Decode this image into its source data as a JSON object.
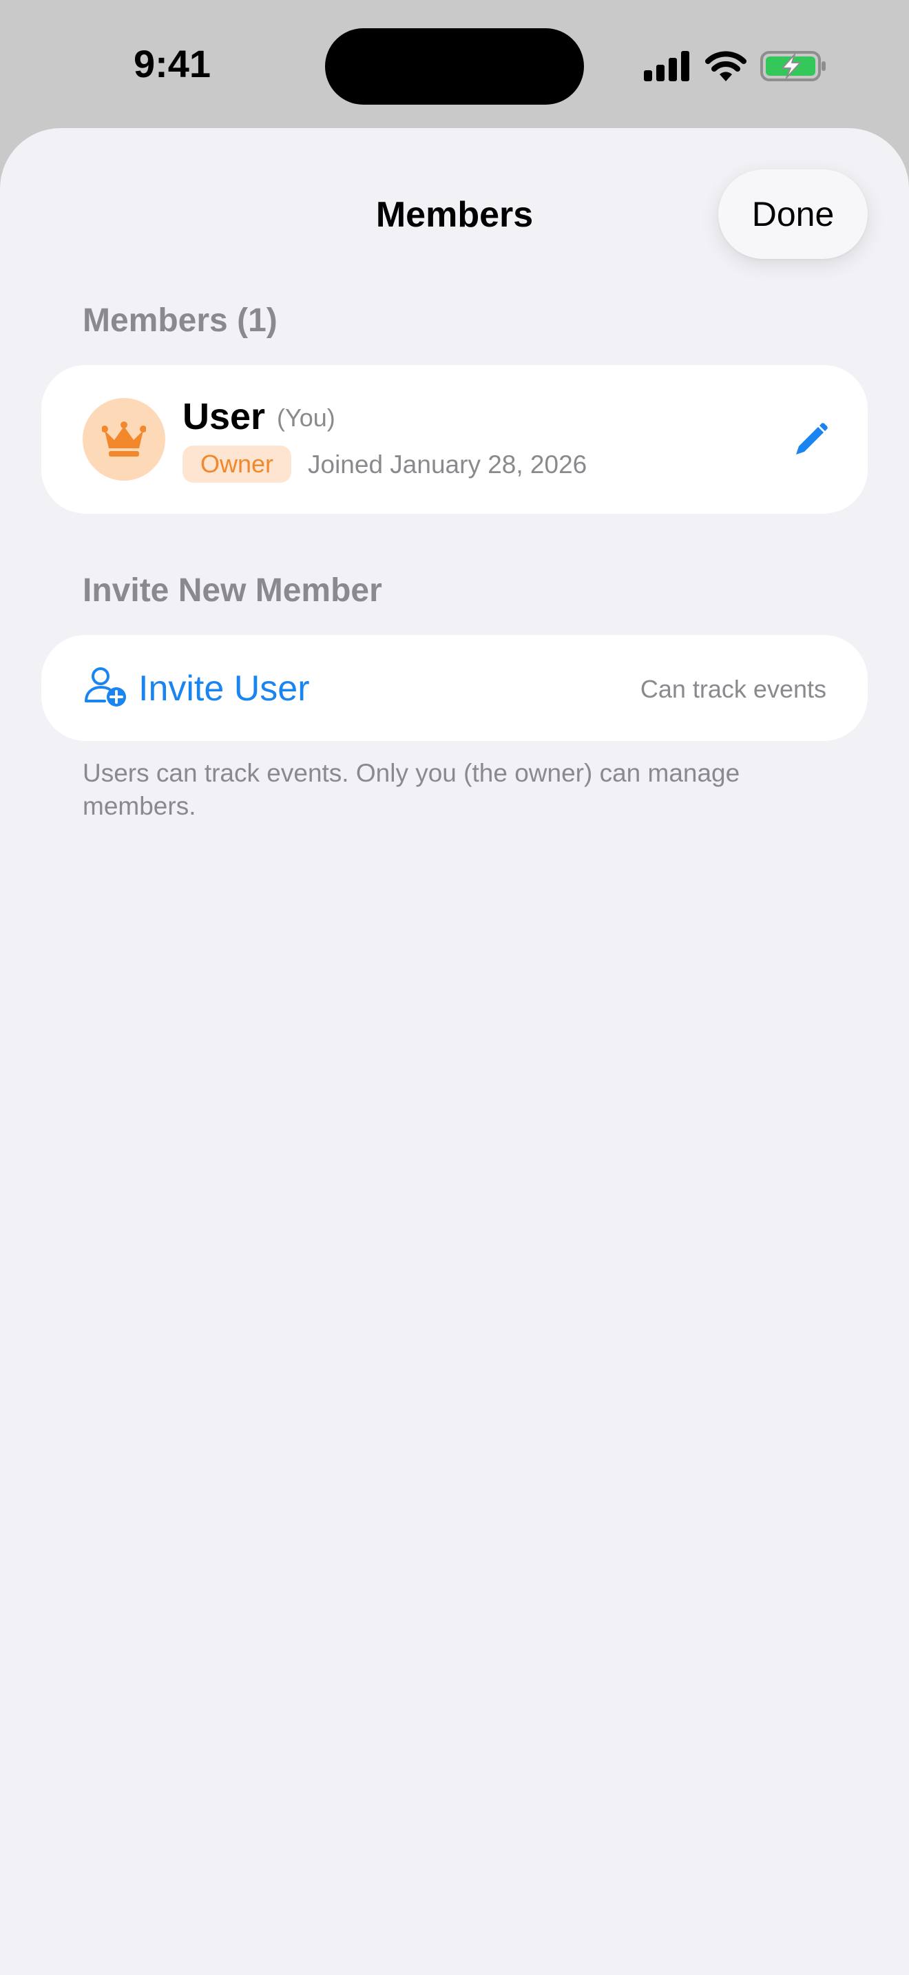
{
  "status_bar": {
    "time": "9:41",
    "icons": [
      "signal-icon",
      "wifi-icon",
      "battery-charging-icon"
    ]
  },
  "nav": {
    "title": "Members",
    "done_label": "Done"
  },
  "members_section": {
    "header": "Members (1)",
    "members": [
      {
        "name": "User",
        "you_label": "(You)",
        "role": "Owner",
        "joined": "Joined January 28, 2026",
        "avatar_icon": "crown-icon",
        "edit_icon": "pencil-icon"
      }
    ]
  },
  "invite_section": {
    "header": "Invite New Member",
    "invite_label": "Invite User",
    "invite_icon": "person-add-icon",
    "hint": "Can track events",
    "footer": "Users can track events. Only you (the owner) can manage members."
  },
  "colors": {
    "accent": "#1a84f0",
    "owner_badge_bg": "#fde5d2",
    "owner_badge_text": "#f2872c",
    "avatar_bg": "#fdd9b8",
    "battery_green": "#34c759",
    "sheet_bg": "#f1f1f6",
    "secondary_text": "#8a8a8e"
  }
}
